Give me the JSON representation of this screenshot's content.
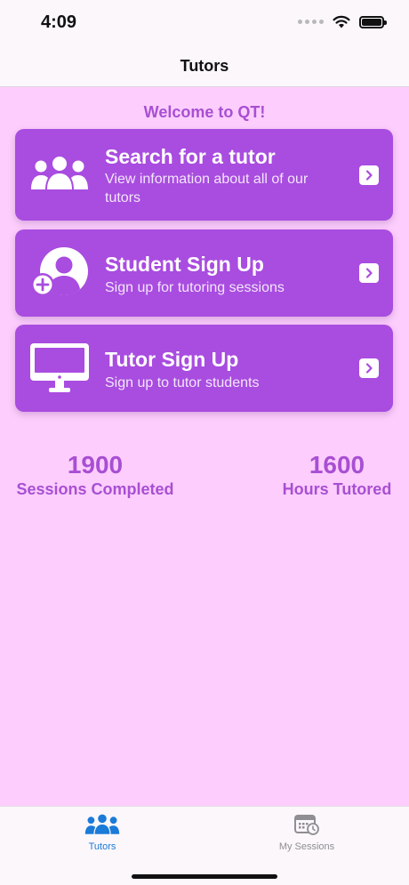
{
  "status_bar": {
    "time": "4:09"
  },
  "nav": {
    "title": "Tutors"
  },
  "welcome": "Welcome to QT!",
  "cards": [
    {
      "title": "Search for a tutor",
      "subtitle": "View information about all of our tutors",
      "icon": "group-icon"
    },
    {
      "title": "Student Sign Up",
      "subtitle": "Sign up for tutoring sessions",
      "icon": "add-user-icon"
    },
    {
      "title": "Tutor Sign Up",
      "subtitle": "Sign up to tutor students",
      "icon": "monitor-icon"
    }
  ],
  "stats": [
    {
      "value": "1900",
      "label": "Sessions Completed"
    },
    {
      "value": "1600",
      "label": "Hours Tutored"
    }
  ],
  "tab_bar": {
    "tabs": [
      {
        "label": "Tutors",
        "icon": "group-icon",
        "selected": true
      },
      {
        "label": "My Sessions",
        "icon": "calendar-clock-icon",
        "selected": false
      }
    ]
  },
  "colors": {
    "accent": "#a94ce0",
    "background": "#fdcefd",
    "stat_text": "#a84fd3",
    "tab_selected": "#1a7bd8",
    "tab_unselected": "#8e8e93"
  }
}
